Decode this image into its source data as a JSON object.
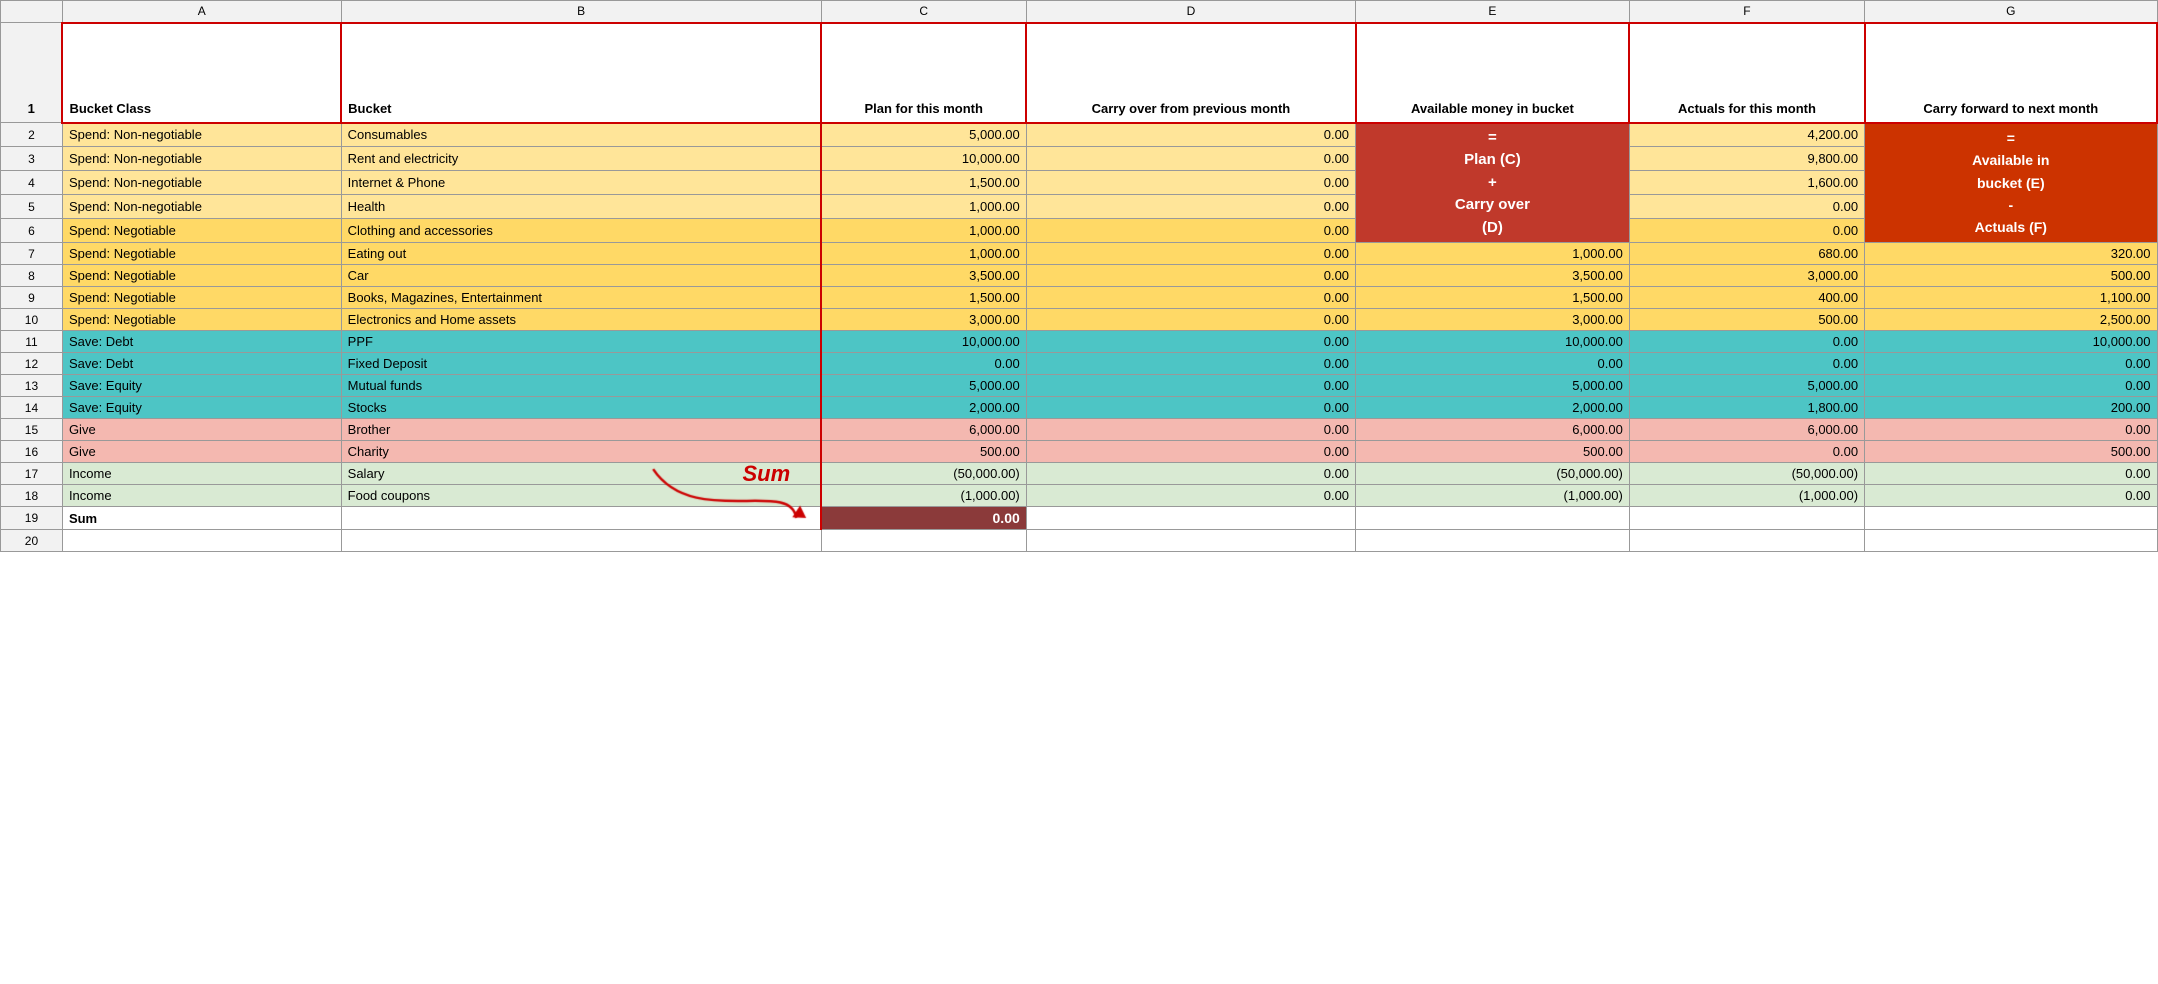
{
  "columns": {
    "letters": [
      "",
      "A",
      "B",
      "C",
      "D",
      "E",
      "F",
      "G"
    ]
  },
  "headers": {
    "row_num": "1",
    "bucket_class": "Bucket Class",
    "bucket": "Bucket",
    "plan": "Plan for this month",
    "carry_over": "Carry over from previous month",
    "available": "Available money in bucket",
    "actuals": "Actuals for this month",
    "carry_forward": "Carry forward to next month"
  },
  "tooltip_e": "= Plan (C) + Carry over (D)",
  "tooltip_g": "Available in bucket (E) - Actuals (F)",
  "sum_annotation": "Sum",
  "rows": [
    {
      "num": 2,
      "class": "Spend: Non-negotiable",
      "bucket": "Consumables",
      "plan": "5,000.00",
      "carry_over": "0.00",
      "available": null,
      "actuals": "4,200.00",
      "carry_forward": null,
      "color": "non-negotiable"
    },
    {
      "num": 3,
      "class": "Spend: Non-negotiable",
      "bucket": "Rent and electricity",
      "plan": "10,000.00",
      "carry_over": "0.00",
      "available": null,
      "actuals": "9,800.00",
      "carry_forward": null,
      "color": "non-negotiable"
    },
    {
      "num": 4,
      "class": "Spend: Non-negotiable",
      "bucket": "Internet & Phone",
      "plan": "1,500.00",
      "carry_over": "0.00",
      "available": null,
      "actuals": "1,600.00",
      "carry_forward": null,
      "color": "non-negotiable"
    },
    {
      "num": 5,
      "class": "Spend: Non-negotiable",
      "bucket": "Health",
      "plan": "1,000.00",
      "carry_over": "0.00",
      "available": null,
      "actuals": "0.00",
      "carry_forward": null,
      "color": "non-negotiable"
    },
    {
      "num": 6,
      "class": "Spend: Negotiable",
      "bucket": "Clothing and accessories",
      "plan": "1,000.00",
      "carry_over": "0.00",
      "available": null,
      "actuals": "0.00",
      "carry_forward": null,
      "color": "negotiable"
    },
    {
      "num": 7,
      "class": "Spend: Negotiable",
      "bucket": "Eating out",
      "plan": "1,000.00",
      "carry_over": "0.00",
      "available": "1,000.00",
      "actuals": "680.00",
      "carry_forward": "320.00",
      "color": "negotiable"
    },
    {
      "num": 8,
      "class": "Spend: Negotiable",
      "bucket": "Car",
      "plan": "3,500.00",
      "carry_over": "0.00",
      "available": "3,500.00",
      "actuals": "3,000.00",
      "carry_forward": "500.00",
      "color": "negotiable"
    },
    {
      "num": 9,
      "class": "Spend: Negotiable",
      "bucket": "Books, Magazines, Entertainment",
      "plan": "1,500.00",
      "carry_over": "0.00",
      "available": "1,500.00",
      "actuals": "400.00",
      "carry_forward": "1,100.00",
      "color": "negotiable"
    },
    {
      "num": 10,
      "class": "Spend: Negotiable",
      "bucket": "Electronics and Home assets",
      "plan": "3,000.00",
      "carry_over": "0.00",
      "available": "3,000.00",
      "actuals": "500.00",
      "carry_forward": "2,500.00",
      "color": "negotiable"
    },
    {
      "num": 11,
      "class": "Save: Debt",
      "bucket": "PPF",
      "plan": "10,000.00",
      "carry_over": "0.00",
      "available": "10,000.00",
      "actuals": "0.00",
      "carry_forward": "10,000.00",
      "color": "save-debt"
    },
    {
      "num": 12,
      "class": "Save: Debt",
      "bucket": "Fixed Deposit",
      "plan": "0.00",
      "carry_over": "0.00",
      "available": "0.00",
      "actuals": "0.00",
      "carry_forward": "0.00",
      "color": "save-debt"
    },
    {
      "num": 13,
      "class": "Save: Equity",
      "bucket": "Mutual funds",
      "plan": "5,000.00",
      "carry_over": "0.00",
      "available": "5,000.00",
      "actuals": "5,000.00",
      "carry_forward": "0.00",
      "color": "save-equity"
    },
    {
      "num": 14,
      "class": "Save: Equity",
      "bucket": "Stocks",
      "plan": "2,000.00",
      "carry_over": "0.00",
      "available": "2,000.00",
      "actuals": "1,800.00",
      "carry_forward": "200.00",
      "color": "save-equity"
    },
    {
      "num": 15,
      "class": "Give",
      "bucket": "Brother",
      "plan": "6,000.00",
      "carry_over": "0.00",
      "available": "6,000.00",
      "actuals": "6,000.00",
      "carry_forward": "0.00",
      "color": "give"
    },
    {
      "num": 16,
      "class": "Give",
      "bucket": "Charity",
      "plan": "500.00",
      "carry_over": "0.00",
      "available": "500.00",
      "actuals": "0.00",
      "carry_forward": "500.00",
      "color": "give"
    },
    {
      "num": 17,
      "class": "Income",
      "bucket": "Salary",
      "plan": "(50,000.00)",
      "carry_over": "0.00",
      "available": "(50,000.00)",
      "actuals": "(50,000.00)",
      "carry_forward": "0.00",
      "color": "income"
    },
    {
      "num": 18,
      "class": "Income",
      "bucket": "Food coupons",
      "plan": "(1,000.00)",
      "carry_over": "0.00",
      "available": "(1,000.00)",
      "actuals": "(1,000.00)",
      "carry_forward": "0.00",
      "color": "income"
    },
    {
      "num": 19,
      "class": "Sum",
      "bucket": "",
      "plan": "",
      "carry_over": "",
      "available": "",
      "actuals": "",
      "carry_forward": "",
      "color": "sum",
      "sum_val": "0.00"
    }
  ]
}
